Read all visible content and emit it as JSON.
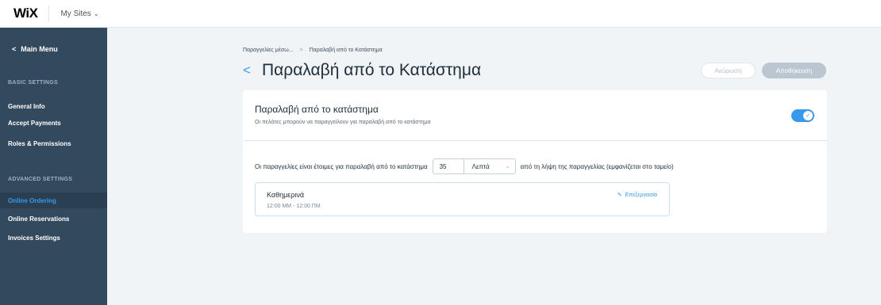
{
  "topbar": {
    "logo": "WiX",
    "my_sites": "My Sites",
    "my_sites_chevron": "⌄"
  },
  "sidebar": {
    "back": "Main Menu",
    "back_icon": "chevron-left-icon",
    "sections": [
      {
        "title": "BASIC SETTINGS",
        "items": [
          "General Info",
          "Accept Payments",
          "Roles & Permissions"
        ]
      },
      {
        "title": "ADVANCED SETTINGS",
        "items": [
          "Online Ordering",
          "Online Reservations",
          "Invoices Settings"
        ]
      }
    ],
    "active_item": "Online Ordering"
  },
  "breadcrumb": {
    "items": [
      "Παραγγελίες μέσω...",
      "Παραλαβή από το Κατάστημα"
    ],
    "separator": ">"
  },
  "page": {
    "title": "Παραλαβή από το Κατάστημα",
    "back_glyph": "<"
  },
  "actions": {
    "cancel": "Ακύρωση",
    "save": "Αποθήκευση"
  },
  "card": {
    "title": "Παραλαβή από το κατάστημα",
    "subtitle": "Οι πελάτες μπορούν να παραγγείλουν για παραλαβή από το κατάστημα",
    "toggle_on": true,
    "ready_prefix": "Οι παραγγελίες είναι έτοιμες για παραλαβή από το κατάστημα",
    "ready_value": "35",
    "ready_unit": "Λεπτά",
    "ready_suffix": "από τη λήψη της παραγγελίας (εμφανίζεται στο ταμείο)",
    "hours": {
      "day": "Καθημερινά",
      "time": "12:00 ΜΜ - 12:00 ΠΜ",
      "edit": "Επεξεργασία"
    }
  },
  "colors": {
    "accent": "#3899ec",
    "sidebar": "#33495e",
    "sidebar_active": "#2b3f52",
    "background": "#f0f4f7"
  }
}
